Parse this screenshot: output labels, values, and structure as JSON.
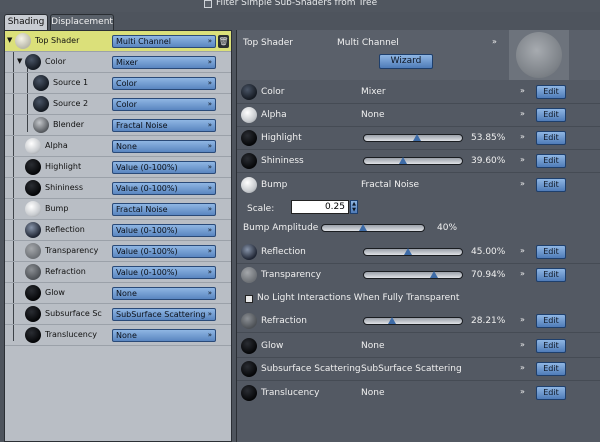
{
  "top_option": {
    "label": "Filter Simple Sub-Shaders from Tree",
    "checked": false
  },
  "tabs": [
    {
      "label": "Shading",
      "active": true
    },
    {
      "label": "Displacement",
      "active": false
    }
  ],
  "tree": [
    {
      "label": "Top Shader",
      "value": "Multi Channel",
      "orb": "lite",
      "selected": true
    },
    {
      "label": "Color",
      "value": "Mixer",
      "orb": "dark"
    },
    {
      "label": "Source 1",
      "value": "Color",
      "orb": "dark"
    },
    {
      "label": "Source 2",
      "value": "Color",
      "orb": "dark"
    },
    {
      "label": "Blender",
      "value": "Fractal Noise",
      "orb": "noise"
    },
    {
      "label": "Alpha",
      "value": "None",
      "orb": "white"
    },
    {
      "label": "Highlight",
      "value": "Value (0-100%)",
      "orb": "black"
    },
    {
      "label": "Shininess",
      "value": "Value (0-100%)",
      "orb": "black"
    },
    {
      "label": "Bump",
      "value": "Fractal Noise",
      "orb": "white"
    },
    {
      "label": "Reflection",
      "value": "Value (0-100%)",
      "orb": "refl"
    },
    {
      "label": "Transparency",
      "value": "Value (0-100%)",
      "orb": "gray"
    },
    {
      "label": "Refraction",
      "value": "Value (0-100%)",
      "orb": "mid"
    },
    {
      "label": "Glow",
      "value": "None",
      "orb": "black"
    },
    {
      "label": "Subsurface Sc",
      "value": "SubSurface Scattering",
      "orb": "black"
    },
    {
      "label": "Translucency",
      "value": "None",
      "orb": "black"
    }
  ],
  "detail": {
    "title": "Top Shader",
    "type": "Multi Channel",
    "wizard_label": "Wizard",
    "edit_label": "Edit",
    "channels": [
      {
        "label": "Color",
        "value": "Mixer",
        "orb": "dark"
      },
      {
        "label": "Alpha",
        "value": "None",
        "orb": "white"
      },
      {
        "label": "Highlight",
        "percent": "53.85%",
        "fraction": 0.5385,
        "orb": "black"
      },
      {
        "label": "Shininess",
        "percent": "39.60%",
        "fraction": 0.396,
        "orb": "black"
      },
      {
        "label": "Bump",
        "value": "Fractal Noise",
        "orb": "white"
      },
      {
        "label": "Reflection",
        "percent": "45.00%",
        "fraction": 0.45,
        "orb": "refl"
      },
      {
        "label": "Transparency",
        "percent": "70.94%",
        "fraction": 0.7094,
        "orb": "gray"
      },
      {
        "label": "Refraction",
        "percent": "28.21%",
        "fraction": 0.2821,
        "orb": "mid"
      },
      {
        "label": "Glow",
        "value": "None",
        "orb": "black"
      },
      {
        "label": "Subsurface Scattering",
        "value": "SubSurface Scattering",
        "orb": "black"
      },
      {
        "label": "Translucency",
        "value": "None",
        "orb": "black"
      }
    ],
    "scale_label": "Scale:",
    "scale_value": "0.25",
    "bump_amplitude_label": "Bump Amplitude",
    "bump_amplitude_percent": "40%",
    "bump_amplitude_fraction": 0.4,
    "no_light_label": "No Light Interactions When Fully Transparent",
    "no_light_checked": false
  },
  "icons": {
    "dropdown": "chevron-double-down-icon",
    "trash": "trash-icon",
    "expand": "triangle-down-icon"
  }
}
